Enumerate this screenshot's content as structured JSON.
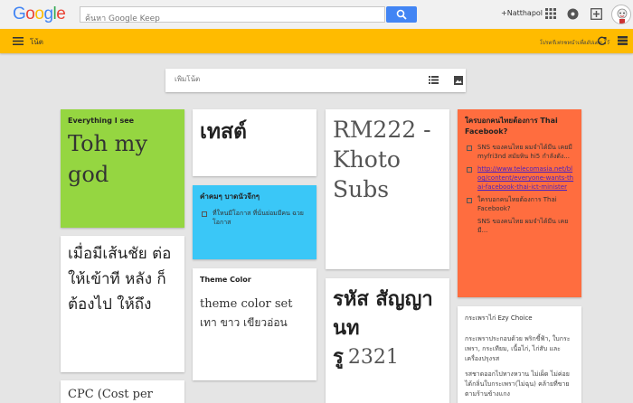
{
  "header": {
    "logo": [
      "G",
      "o",
      "o",
      "g",
      "l",
      "e"
    ],
    "search_placeholder": "ค้นหา Google Keep",
    "user_name": "+Natthapol"
  },
  "keepbar": {
    "title": "โน้ต",
    "refresh_note": "โปรดรีเฟรชหน้าเพื่ออัปเดต ไว้"
  },
  "take_note": {
    "placeholder": "เพิ่มโน้ต"
  },
  "notes": {
    "everything": {
      "title": "Everything I see",
      "body": "Toh my god"
    },
    "thai_long": {
      "body": "เมื่อมีเส้นชัย ต่อให้เข้าที หลัง ก็ต้องไป ให้ถึง"
    },
    "cpc": {
      "body": "CPC (Cost per"
    },
    "test": {
      "body": "เทสต์"
    },
    "blue": {
      "title": "คำคมๆ บาดนัวจีกๆ",
      "item1": "ที่ใหนมีโอกาส ที่นั่นย่อมมีคน ฉวยโอกาส"
    },
    "theme": {
      "title": "Theme Color",
      "line1": "theme color set",
      "line2": "เทา ขาว เขียวอ่อน"
    },
    "rm": {
      "body": "RM222 - Khoto Subs"
    },
    "code_title": "รหัส สัญญานท",
    "code_prefix": "รู",
    "code_num": "2321",
    "orange": {
      "title": "ใครบอกคนไทยต้องการ Thai Facebook?",
      "items": [
        "SNS ของคนไทย ผมจำได้มีน เคยมี myfri3nd สมัยหิน hi5 กำลังดัง...",
        "http://www.telecomasia.net/blog/content/everyone-wants-thai-facebook-thai-ict-minister",
        "ใครบอกคนไทยต้องการ Thai Facebook?",
        "SNS ของคนไทย ผมจำได้มีน เคยมี..."
      ]
    },
    "ezy": {
      "title": "กระเพราไก่ Ezy Choice",
      "para1": "กระเพราประกอบด้วย พริกขี้ฟ้า, ใบกระเพรา, กระเทียม, เนื้อไก่, ไก่สับ และเครื่องปรุงรส",
      "para2": "รสชาดออกไปทางหวาน ไม่เผ็ด ไม่ค่อยได้กลิ่นใบกระเพรา(ไม่ฉุน) คล้ายที่ขายตามร้านข้างแกง"
    }
  },
  "colors": {
    "keep_yellow": "#ffbb00",
    "note_green": "#95d641",
    "note_blue": "#3ac7f7",
    "note_orange": "#ff6d3f",
    "search_blue": "#4285f4"
  },
  "icons": [
    "search-icon",
    "apps-grid-icon",
    "notifications-icon",
    "share-plus-icon",
    "menu-icon",
    "refresh-icon",
    "list-view-icon",
    "list-icon",
    "image-icon",
    "checkbox-icon"
  ]
}
